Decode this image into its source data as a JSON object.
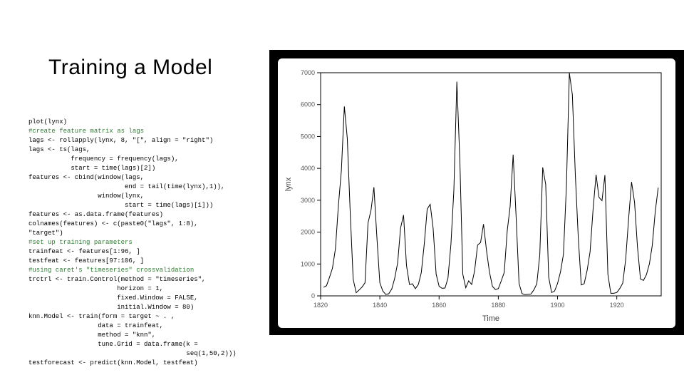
{
  "title": "Training a Model",
  "code": {
    "lines": [
      {
        "t": "plot(lynx)"
      },
      {
        "t": "#create feature matrix as lags",
        "c": true
      },
      {
        "t": "lags <- rollapply(lynx, 8, \"[\", align = \"right\")"
      },
      {
        "t": "lags <- ts(lags,"
      },
      {
        "t": "           frequency = frequency(lags),"
      },
      {
        "t": "           start = time(lags)[2])"
      },
      {
        "t": "features <- cbind(window(lags,"
      },
      {
        "t": "                         end = tail(time(lynx),1)),"
      },
      {
        "t": "                  window(lynx,"
      },
      {
        "t": "                         start = time(lags)[1]))"
      },
      {
        "t": "features <- as.data.frame(features)"
      },
      {
        "t": "colnames(features) <- c(paste0(\"lags\", 1:8),"
      },
      {
        "t": "\"target\")"
      },
      {
        "t": "#set up training parameters",
        "c": true
      },
      {
        "t": "trainfeat <- features[1:96, ]"
      },
      {
        "t": "testfeat <- features[97:106, ]"
      },
      {
        "t": "#using caret's \"timeseries\" crossvalidation",
        "c": true
      },
      {
        "t": "trctrl <- train.Control(method = \"timeseries\","
      },
      {
        "t": "                       horizon = 1,"
      },
      {
        "t": "                       fixed.Window = FALSE,"
      },
      {
        "t": "                       initial.Window = 80)"
      },
      {
        "t": "knn.Model <- train(form = target ~ . ,"
      },
      {
        "t": "                  data = trainfeat,"
      },
      {
        "t": "                  method = \"knn\","
      },
      {
        "t": "                  tune.Grid = data.frame(k ="
      },
      {
        "t": "                                         seq(1,50,2)))"
      },
      {
        "t": "testforecast <- predict(knn.Model, testfeat)"
      }
    ]
  },
  "chart_data": {
    "type": "line",
    "title": "",
    "xlabel": "Time",
    "ylabel": "lynx",
    "xlim": [
      1820,
      1935
    ],
    "ylim": [
      0,
      7000
    ],
    "xticks": [
      1820,
      1840,
      1860,
      1880,
      1900,
      1920
    ],
    "yticks": [
      0,
      1000,
      2000,
      3000,
      4000,
      5000,
      6000,
      7000
    ],
    "series": [
      {
        "name": "lynx",
        "x": [
          1821,
          1822,
          1823,
          1824,
          1825,
          1826,
          1827,
          1828,
          1829,
          1830,
          1831,
          1832,
          1833,
          1834,
          1835,
          1836,
          1837,
          1838,
          1839,
          1840,
          1841,
          1842,
          1843,
          1844,
          1845,
          1846,
          1847,
          1848,
          1849,
          1850,
          1851,
          1852,
          1853,
          1854,
          1855,
          1856,
          1857,
          1858,
          1859,
          1860,
          1861,
          1862,
          1863,
          1864,
          1865,
          1866,
          1867,
          1868,
          1869,
          1870,
          1871,
          1872,
          1873,
          1874,
          1875,
          1876,
          1877,
          1878,
          1879,
          1880,
          1881,
          1882,
          1883,
          1884,
          1885,
          1886,
          1887,
          1888,
          1889,
          1890,
          1891,
          1892,
          1893,
          1894,
          1895,
          1896,
          1897,
          1898,
          1899,
          1900,
          1901,
          1902,
          1903,
          1904,
          1905,
          1906,
          1907,
          1908,
          1909,
          1910,
          1911,
          1912,
          1913,
          1914,
          1915,
          1916,
          1917,
          1918,
          1919,
          1920,
          1921,
          1922,
          1923,
          1924,
          1925,
          1926,
          1927,
          1928,
          1929,
          1930,
          1931,
          1932,
          1933,
          1934
        ],
        "y": [
          269,
          321,
          585,
          871,
          1475,
          2821,
          3928,
          5943,
          4950,
          2577,
          523,
          98,
          184,
          279,
          409,
          2285,
          2685,
          3409,
          1824,
          409,
          151,
          45,
          68,
          213,
          546,
          1033,
          2129,
          2536,
          957,
          361,
          377,
          225,
          360,
          731,
          1638,
          2725,
          2871,
          2119,
          684,
          299,
          236,
          245,
          552,
          1623,
          3311,
          6721,
          4254,
          687,
          255,
          473,
          358,
          784,
          1594,
          1676,
          2251,
          1426,
          756,
          299,
          201,
          229,
          469,
          736,
          2042,
          2811,
          4431,
          2511,
          389,
          73,
          39,
          49,
          59,
          188,
          377,
          1292,
          4031,
          3495,
          587,
          105,
          153,
          387,
          758,
          1307,
          3465,
          6991,
          6313,
          3794,
          1836,
          345,
          382,
          808,
          1388,
          2713,
          3800,
          3091,
          2985,
          3790,
          674,
          81,
          80,
          108,
          229,
          399,
          1132,
          2432,
          3574,
          2935,
          1537,
          529,
          485,
          662,
          1000,
          1590,
          2657,
          3396
        ]
      }
    ]
  }
}
